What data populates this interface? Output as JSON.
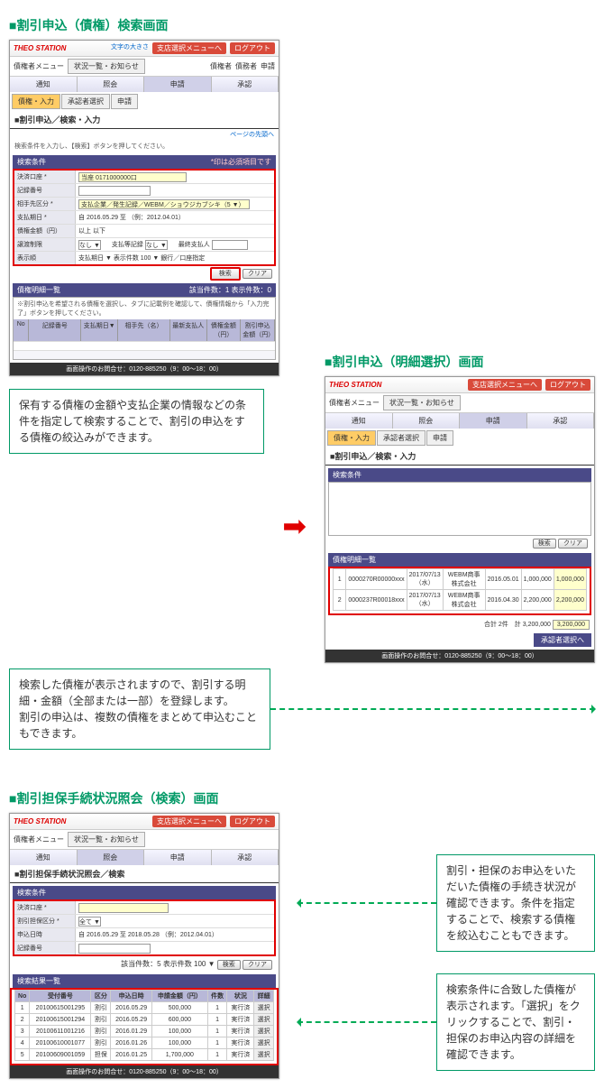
{
  "titles": {
    "search": "■割引申込（債権）検索画面",
    "select": "■割引申込（明細選択）画面",
    "status": "■割引担保手続状況照会（検索）画面"
  },
  "app": {
    "logo": "THEO STATION",
    "menu_label": "債権者メニュー",
    "font_label": "文字の大きさ",
    "help": "画面操作のお問合せ：0120-885250（9：00〜18：00）",
    "topmenu_btn": "支店選択メニューへ",
    "logout_btn": "ログアウト",
    "tabs": [
      "債権者",
      "債務者",
      "申請"
    ],
    "subtabs": [
      "状況一覧・お知らせ"
    ],
    "nav": [
      "通知",
      "照会",
      "申請",
      "承認"
    ],
    "status_tabs": [
      "債権・入力",
      "承認者選択",
      "申請"
    ]
  },
  "search_page": {
    "title": "■割引申込／検索・入力",
    "back": "ページの先頭へ",
    "note": "検索条件を入力し、【検索】ボタンを押してください。",
    "panel": "検索条件",
    "required": "*印は必須項目です",
    "fields": {
      "account": "決済口座 *",
      "account_val": "当座 0171000000口",
      "record": "記録番号",
      "partner": "相手先区分 *",
      "partner_val": "支払企業／発生記録／WEBM／ショウジカブシキ（5 ▼）",
      "due": "支払期日 *",
      "due_val": "自  2016.05.29  至  （例：2012.04.01）",
      "amount": "債権金額（円）",
      "amount_val": "以上  以下",
      "trans": "譲渡制限",
      "trans_val": "なし ▼",
      "guar": "支払等記録",
      "guar_val": "なし ▼",
      "final": "最終支払人",
      "sort": "表示順",
      "sort_val": "支払期日 ▼  表示件数  100 ▼  銀行／口座指定"
    },
    "buttons": {
      "search": "検索",
      "clear": "クリア"
    },
    "results": {
      "head": "債権明細一覧",
      "count": "該当件数：1  表示件数：0",
      "note": "※割引申込を希望される債権を選択し、タブに記載例を確認して、債権情報から「入力完了」ボタンを押してください。",
      "cols": [
        "No",
        "記録番号",
        "支払期日▼",
        "相手先（名）",
        "最新支払人",
        "債権金額（円）",
        "割引申込金額（円）"
      ]
    }
  },
  "select_page": {
    "rows": [
      {
        "no": "1",
        "rec": "0000270R00000xxx",
        "date": "2017/07/13（水）",
        "comp": "WEBM商事株式会社",
        "pay": "株式会社",
        "date2": "2016.05.01",
        "amt": "1,000,000",
        "amt2": "1,000,000"
      },
      {
        "no": "2",
        "rec": "0000237R00018xxx",
        "date": "2017/07/13（水）",
        "comp": "WEBM商事株式会社",
        "pay": "株式会社",
        "date2": "2016.04.30",
        "amt": "2,200,000",
        "amt2": "2,200,000"
      }
    ],
    "total_label": "合計 2件　計 3,200,000",
    "total_amt": "3,200,000",
    "next": "承認者選択へ"
  },
  "status_page": {
    "title": "■割引担保手続状況照会／検索",
    "panel": "検索条件",
    "fields": {
      "account": "決済口座 *",
      "type": "割引担保区分 *",
      "type_val": "全て ▼",
      "date": "申込日時",
      "date_val": "自  2016.05.29  至  2018.05.28  （例：2012.04.01）",
      "record": "記録番号"
    },
    "count_label": "該当件数：5",
    "disp_label": "表示件数  100 ▼",
    "results": {
      "head": "検索結果一覧",
      "cols": [
        "No",
        "受付番号",
        "区分",
        "申込日時",
        "申請金額（円）",
        "件数",
        "状況",
        "詳細"
      ],
      "rows": [
        {
          "no": "1",
          "rec": "20100615001295",
          "type": "割引",
          "date": "2016.05.29",
          "amt": "500,000",
          "cnt": "1",
          "stat": "実行済",
          "sel": "選択"
        },
        {
          "no": "2",
          "rec": "20100615001294",
          "type": "割引",
          "date": "2016.05.29",
          "amt": "600,000",
          "cnt": "1",
          "stat": "実行済",
          "sel": "選択"
        },
        {
          "no": "3",
          "rec": "20100611001216",
          "type": "割引",
          "date": "2016.01.29",
          "amt": "100,000",
          "cnt": "1",
          "stat": "実行済",
          "sel": "選択"
        },
        {
          "no": "4",
          "rec": "20100610001077",
          "type": "割引",
          "date": "2016.01.26",
          "amt": "100,000",
          "cnt": "1",
          "stat": "実行済",
          "sel": "選択"
        },
        {
          "no": "5",
          "rec": "20100609001059",
          "type": "担保",
          "date": "2016.01.25",
          "amt": "1,700,000",
          "cnt": "1",
          "stat": "実行済",
          "sel": "選択"
        }
      ]
    }
  },
  "captions": {
    "c1": "保有する債権の金額や支払企業の情報などの条件を指定して検索することで、割引の申込をする債権の絞込みができます。",
    "c2": "検索した債権が表示されますので、割引する明細・金額（全部または一部）を登録します。\n割引の申込は、複数の債権をまとめて申込むこともできます。",
    "c3": "割引・担保のお申込をいただいた債権の手続き状況が確認できます。条件を指定することで、検索する債権を絞込むこともできます。",
    "c4": "検索条件に合致した債権が表示されます。「選択」をクリックすることで、割引・担保のお申込内容の詳細を確認できます。"
  }
}
